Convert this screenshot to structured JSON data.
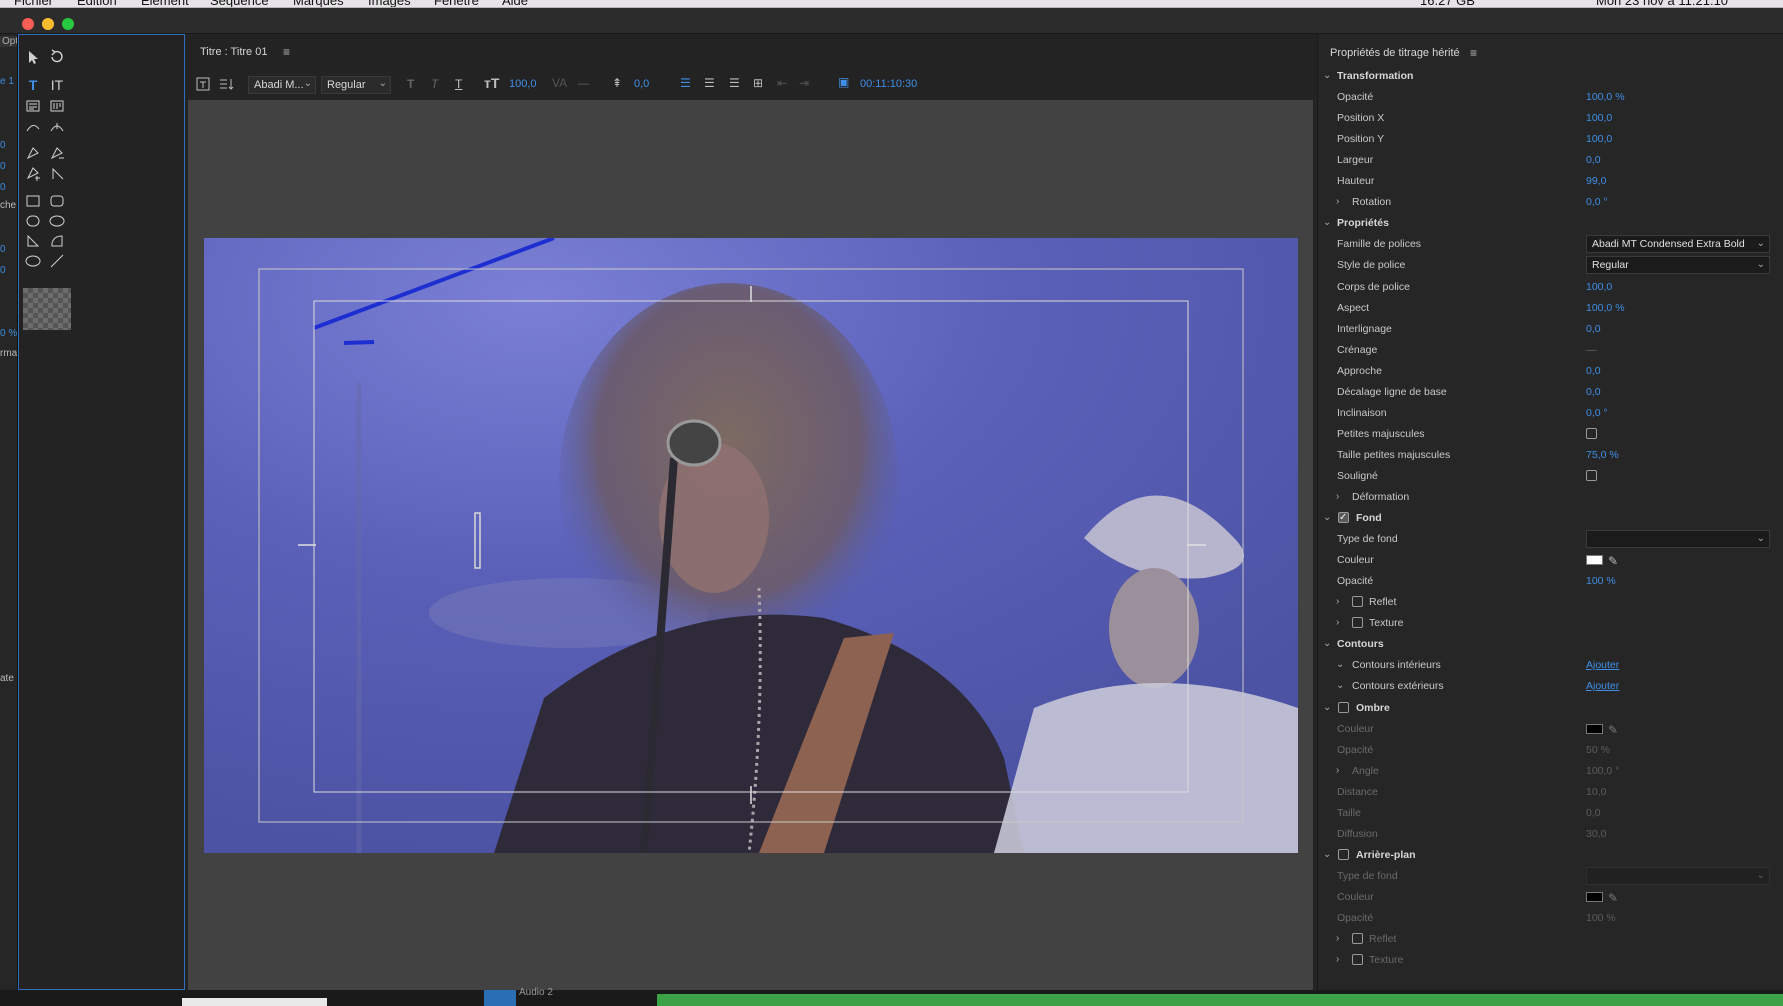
{
  "menubar": {
    "items": [
      "Fichier",
      "Édition",
      "Élément",
      "Séquence",
      "Marques",
      "Images",
      "Fenêtre",
      "Aide"
    ],
    "memory": "16.27 GB",
    "clock": "Mon 23 nov à 11:21:10"
  },
  "leftstrip": {
    "labels": [
      "Opt",
      "e 1",
      "0",
      "0",
      "0",
      "che",
      "0",
      "0",
      "0 %",
      "rma",
      "ate"
    ]
  },
  "editor": {
    "tab_title": "Titre : Titre 01",
    "font_family_short": "Abadi M...",
    "font_style": "Regular",
    "font_size": "100,0",
    "kerning_dash": "—",
    "leading": "0,0",
    "timecode": "00:11:10:30"
  },
  "panel": {
    "title": "Propriétés de titrage hérité",
    "rows": [
      {
        "kind": "section",
        "label": "Transformation"
      },
      {
        "label": "Opacité",
        "value": "100,0 %"
      },
      {
        "label": "Position X",
        "value": "100,0"
      },
      {
        "label": "Position Y",
        "value": "100,0"
      },
      {
        "label": "Largeur",
        "value": "0,0"
      },
      {
        "label": "Hauteur",
        "value": "99,0"
      },
      {
        "kind": "sub",
        "label": "Rotation",
        "value": "0,0 °"
      },
      {
        "kind": "section",
        "label": "Propriétés"
      },
      {
        "label": "Famille de polices",
        "select": "Abadi MT Condensed Extra Bold"
      },
      {
        "label": "Style de police",
        "select": "Regular"
      },
      {
        "label": "Corps de police",
        "value": "100,0"
      },
      {
        "label": "Aspect",
        "value": "100,0 %"
      },
      {
        "label": "Interlignage",
        "value": "0,0"
      },
      {
        "label": "Crénage",
        "value": "—",
        "dimval": true
      },
      {
        "label": "Approche",
        "value": "0,0"
      },
      {
        "label": "Décalage ligne de base",
        "value": "0,0"
      },
      {
        "label": "Inclinaison",
        "value": "0,0 °"
      },
      {
        "label": "Petites majuscules",
        "checkbox": false
      },
      {
        "label": "Taille petites majuscules",
        "value": "75,0 %"
      },
      {
        "label": "Souligné",
        "checkbox": false
      },
      {
        "kind": "sub",
        "label": "Déformation"
      },
      {
        "kind": "section",
        "label": "Fond",
        "check": true
      },
      {
        "label": "Type de fond",
        "select": ""
      },
      {
        "label": "Couleur",
        "color": "#ffffff"
      },
      {
        "label": "Opacité",
        "value": "100 %"
      },
      {
        "kind": "subcheck",
        "label": "Reflet"
      },
      {
        "kind": "subcheck",
        "label": "Texture"
      },
      {
        "kind": "section",
        "label": "Contours"
      },
      {
        "kind": "subopen",
        "label": "Contours intérieurs",
        "link": "Ajouter"
      },
      {
        "kind": "subopen",
        "label": "Contours extérieurs",
        "link": "Ajouter"
      },
      {
        "kind": "section",
        "label": "Ombre",
        "check": false
      },
      {
        "label": "Couleur",
        "color": "#000000",
        "dim": true
      },
      {
        "label": "Opacité",
        "value": "50 %",
        "dim": true
      },
      {
        "kind": "sub",
        "label": "Angle",
        "value": "100,0 °",
        "dim": true
      },
      {
        "label": "Distance",
        "value": "10,0",
        "dim": true
      },
      {
        "label": "Taille",
        "value": "0,0",
        "dim": true
      },
      {
        "label": "Diffusion",
        "value": "30,0",
        "dim": true
      },
      {
        "kind": "section",
        "label": "Arrière-plan",
        "check": false
      },
      {
        "label": "Type de fond",
        "select": "",
        "dim": true
      },
      {
        "label": "Couleur",
        "color": "#000000",
        "dim": true
      },
      {
        "label": "Opacité",
        "value": "100 %",
        "dim": true
      },
      {
        "kind": "subcheck",
        "label": "Reflet",
        "dim": true
      },
      {
        "kind": "subcheck",
        "label": "Texture",
        "dim": true
      }
    ]
  },
  "bottom": {
    "track_label": "Audio 2"
  },
  "colors": {
    "accent": "#3f8fe6",
    "panel": "#262626",
    "canvas": "#424242"
  }
}
